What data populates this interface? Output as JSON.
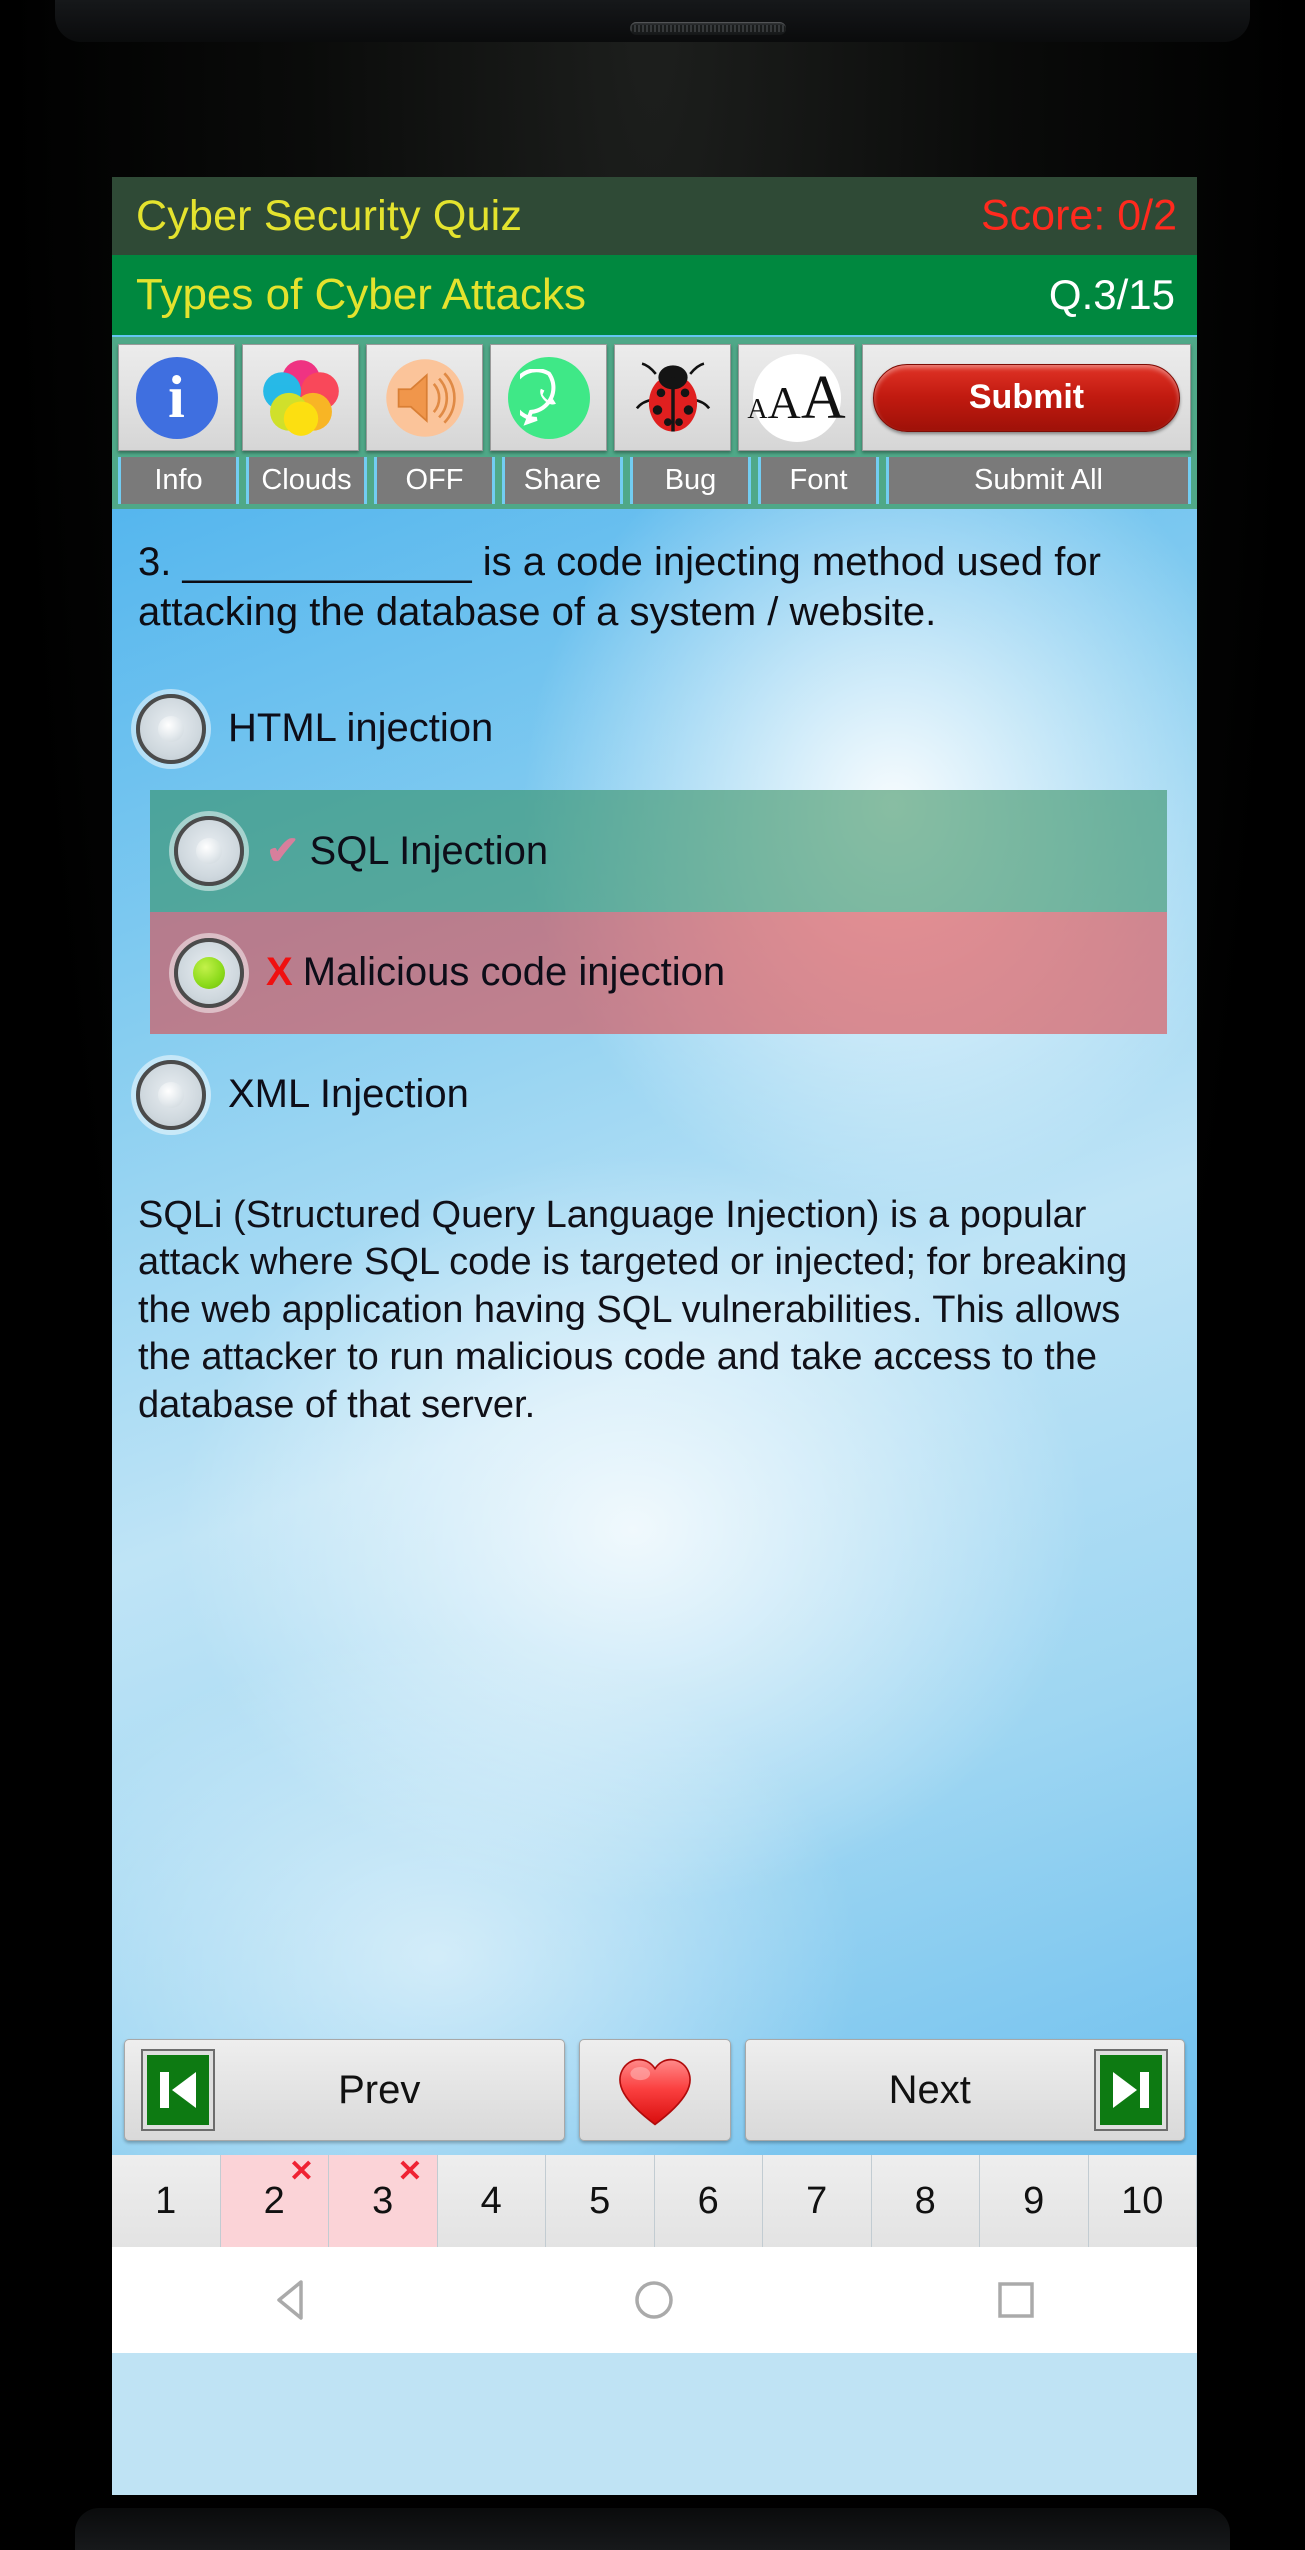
{
  "app": {
    "title": "Cyber Security Quiz",
    "score": "Score: 0/2",
    "subject": "Types of Cyber Attacks",
    "question_index": "Q.3/15"
  },
  "toolbar": {
    "items": [
      {
        "label": "Info",
        "icon": "info-icon",
        "glyph": "i"
      },
      {
        "label": "Clouds",
        "icon": "clouds-icon",
        "glyph": ""
      },
      {
        "label": "OFF",
        "icon": "speaker-icon",
        "glyph": ""
      },
      {
        "label": "Share",
        "icon": "whatsapp-icon",
        "glyph": ""
      },
      {
        "label": "Bug",
        "icon": "bug-icon",
        "glyph": ""
      },
      {
        "label": "Font",
        "icon": "font-size-icon",
        "glyph": "AAA"
      },
      {
        "label": "Submit All",
        "icon": "submit-icon",
        "glyph": "Submit"
      }
    ],
    "submit_label": "Submit",
    "font_a_small": "A",
    "font_a_mid": "A",
    "font_a_large": "A"
  },
  "question": {
    "number": "3.",
    "text": "3. _____________ is a code injecting method used for attacking the database of a system / website.",
    "options": [
      {
        "label": "HTML injection",
        "state": "none",
        "mark": "",
        "selected": false
      },
      {
        "label": "SQL Injection",
        "state": "correct",
        "mark": "✔",
        "selected": false
      },
      {
        "label": "Malicious code injection",
        "state": "wrong",
        "mark": "X",
        "selected": true
      },
      {
        "label": "XML Injection",
        "state": "none",
        "mark": "",
        "selected": false
      }
    ],
    "explanation": "SQLi (Structured Query Language Injection) is a popular attack where SQL code is targeted or injected; for breaking the web application having SQL vulnerabilities. This allows the attacker to run malicious code and take access to the database of that server."
  },
  "navigation": {
    "prev_label": "Prev",
    "next_label": "Next",
    "favorite_icon": "heart-icon",
    "prev_icon": "skip-back-icon",
    "next_icon": "skip-forward-icon"
  },
  "pages": [
    {
      "number": "1",
      "status": "none"
    },
    {
      "number": "2",
      "status": "wrong"
    },
    {
      "number": "3",
      "status": "wrong"
    },
    {
      "number": "4",
      "status": "none"
    },
    {
      "number": "5",
      "status": "none"
    },
    {
      "number": "6",
      "status": "none"
    },
    {
      "number": "7",
      "status": "none"
    },
    {
      "number": "8",
      "status": "none"
    },
    {
      "number": "9",
      "status": "none"
    },
    {
      "number": "10",
      "status": "none"
    }
  ],
  "page_wrong_mark": "✕",
  "android": {
    "back": "back-nav-icon",
    "home": "home-nav-icon",
    "recents": "recents-nav-icon"
  },
  "colors": {
    "appbar": "#2f4a36",
    "subjectbar": "#00883f",
    "title_yellow": "#e4e32e",
    "score_red": "#ff2a1e",
    "toolbar_teal": "#4fa888",
    "correct_green": "#2e8b57",
    "wrong_red": "#e43c3c",
    "submit_red": "#c11a10"
  }
}
